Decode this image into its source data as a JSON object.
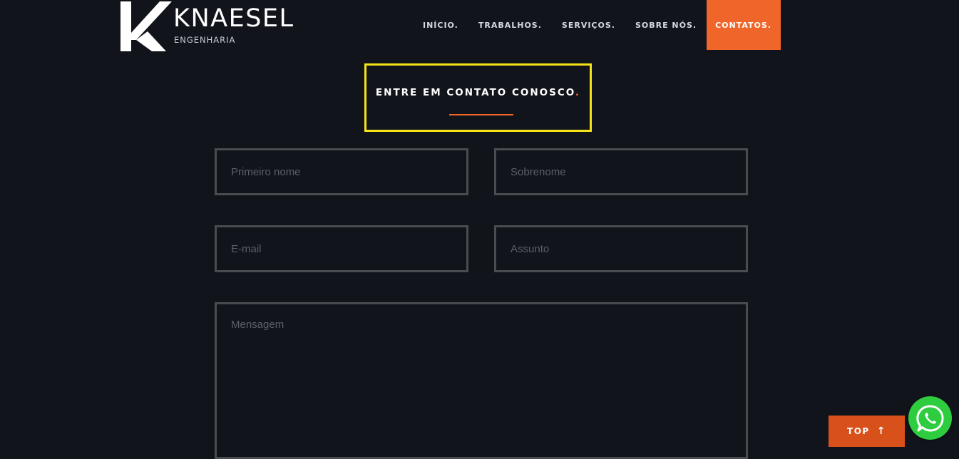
{
  "logo": {
    "name": "KNAESEL",
    "subtitle": "ENGENHARIA"
  },
  "nav": {
    "items": [
      {
        "label": "INÍCIO."
      },
      {
        "label": "TRABALHOS."
      },
      {
        "label": "SERVIÇOS."
      },
      {
        "label": "SOBRE NÓS."
      },
      {
        "label": "CONTATOS."
      }
    ],
    "active_index": 4
  },
  "heading": {
    "text": "ENTRE EM CONTATO CONOSCO",
    "dot": "."
  },
  "form": {
    "first_name_placeholder": "Primeiro nome",
    "last_name_placeholder": "Sobrenome",
    "email_placeholder": "E-mail",
    "subject_placeholder": "Assunto",
    "message_placeholder": "Mensagem"
  },
  "top_button": {
    "label": "TOP",
    "arrow": "↑"
  },
  "icons": {
    "whatsapp": "whatsapp-icon",
    "arrow": "arrow-up-icon"
  },
  "colors": {
    "accent": "#f0662a",
    "highlight_border": "#f5e31a",
    "background": "#12141c",
    "whatsapp": "#2ecc3f"
  }
}
